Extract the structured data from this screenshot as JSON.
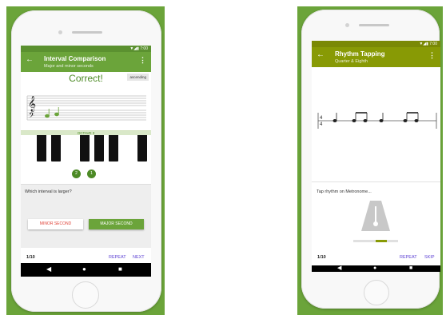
{
  "colors": {
    "green": "#6ba43a",
    "olive": "#889a05",
    "purple": "#5b3fd3",
    "red": "#e0443a"
  },
  "left": {
    "status": {
      "time": "7:00"
    },
    "appbar": {
      "title": "Interval Comparison",
      "subtitle": "Major and minor seconds"
    },
    "feedback": "Correct!",
    "direction_badge": "ascending",
    "octave_label": "OCTAVE 3",
    "key_markers": [
      "2",
      "1"
    ],
    "question": "Which interval is larger?",
    "answers": {
      "minor": "MINOR SECOND",
      "major": "MAJOR SECOND"
    },
    "progress": "1/10",
    "actions": {
      "repeat": "REPEAT",
      "next": "NEXT"
    }
  },
  "right": {
    "status": {
      "time": "7:00"
    },
    "appbar": {
      "title": "Rhythm Tapping",
      "subtitle": "Quarter & Eighth"
    },
    "time_signature": {
      "top": "4",
      "bottom": "4"
    },
    "instruction": "Tap rhythm on Metronome...",
    "progress": "1/10",
    "actions": {
      "repeat": "REPEAT",
      "skip": "SKIP"
    }
  },
  "nav_icons": [
    "back-triangle-icon",
    "home-circle-icon",
    "recents-square-icon"
  ]
}
